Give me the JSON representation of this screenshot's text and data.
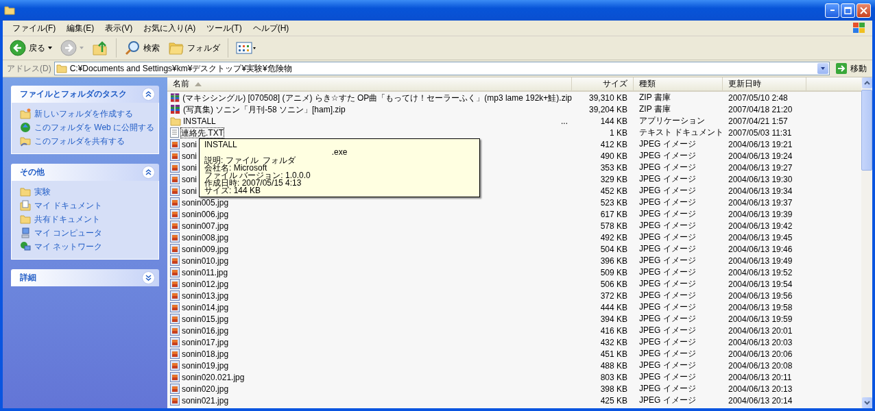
{
  "menu": [
    "ファイル(F)",
    "編集(E)",
    "表示(V)",
    "お気に入り(A)",
    "ツール(T)",
    "ヘルプ(H)"
  ],
  "toolbar": [
    {
      "kind": "back",
      "label": "戻る"
    },
    {
      "kind": "forward"
    },
    {
      "kind": "up"
    },
    {
      "kind": "search",
      "label": "検索"
    },
    {
      "kind": "folders",
      "label": "フォルダ"
    },
    {
      "kind": "views"
    }
  ],
  "address": {
    "label": "アドレス(D)",
    "value": "C:¥Documents and Settings¥km¥デスクトップ¥実験¥危険物",
    "go": "移動"
  },
  "task_panels": [
    {
      "title": "ファイルとフォルダのタスク",
      "expanded": true,
      "items": [
        {
          "kind": "new-folder",
          "label": "新しいフォルダを作成する"
        },
        {
          "kind": "globe",
          "label": "このフォルダを Web に公開する"
        },
        {
          "kind": "share",
          "label": "このフォルダを共有する"
        }
      ]
    },
    {
      "title": "その他",
      "expanded": true,
      "items": [
        {
          "kind": "folder",
          "label": "実験"
        },
        {
          "kind": "documents",
          "label": "マイ ドキュメント"
        },
        {
          "kind": "folder",
          "label": "共有ドキュメント"
        },
        {
          "kind": "computer",
          "label": "マイ コンピュータ"
        },
        {
          "kind": "network",
          "label": "マイ ネットワーク"
        }
      ]
    },
    {
      "title": "詳細",
      "expanded": false
    }
  ],
  "list": {
    "columns": [
      {
        "label": "名前",
        "sorted": true
      },
      {
        "label": "サイズ",
        "sorted": false
      },
      {
        "label": "種類",
        "sorted": false
      },
      {
        "label": "更新日時",
        "sorted": false
      }
    ],
    "rows": [
      {
        "kind": "zip",
        "name": "(マキシシングル) [070508] (アニメ) らき☆すた OP曲「もってけ！セーラーふく」(mp3 lame 192k+鮭).zip",
        "size": "39,310 KB",
        "type": "ZIP 書庫",
        "modified": "2007/05/10 2:48",
        "focused": false
      },
      {
        "kind": "zip",
        "name": "(写真集) ソニン「月刊-58 ソニン」[ham].zip",
        "size": "39,204 KB",
        "type": "ZIP 書庫",
        "modified": "2007/04/18 21:20",
        "focused": false
      },
      {
        "kind": "folder",
        "name": "INSTALL",
        "trailing": "...",
        "size": "144 KB",
        "type": "アプリケーション",
        "modified": "2007/04/21 1:57",
        "focused": false
      },
      {
        "kind": "text",
        "name": "連絡先.TXT",
        "size": "1 KB",
        "type": "テキスト ドキュメント",
        "modified": "2007/05/03 11:31",
        "focused": true
      },
      {
        "kind": "jpeg",
        "name": "soni",
        "size": "412 KB",
        "type": "JPEG イメージ",
        "modified": "2004/06/13 19:21",
        "focused": false
      },
      {
        "kind": "jpeg",
        "name": "soni",
        "size": "490 KB",
        "type": "JPEG イメージ",
        "modified": "2004/06/13 19:24",
        "focused": false
      },
      {
        "kind": "jpeg",
        "name": "soni",
        "size": "353 KB",
        "type": "JPEG イメージ",
        "modified": "2004/06/13 19:27",
        "focused": false
      },
      {
        "kind": "jpeg",
        "name": "soni",
        "size": "329 KB",
        "type": "JPEG イメージ",
        "modified": "2004/06/13 19:30",
        "focused": false
      },
      {
        "kind": "jpeg",
        "name": "soni",
        "size": "452 KB",
        "type": "JPEG イメージ",
        "modified": "2004/06/13 19:34",
        "focused": false
      },
      {
        "kind": "jpeg",
        "name": "sonin005.jpg",
        "size": "523 KB",
        "type": "JPEG イメージ",
        "modified": "2004/06/13 19:37",
        "focused": false
      },
      {
        "kind": "jpeg",
        "name": "sonin006.jpg",
        "size": "617 KB",
        "type": "JPEG イメージ",
        "modified": "2004/06/13 19:39",
        "focused": false
      },
      {
        "kind": "jpeg",
        "name": "sonin007.jpg",
        "size": "578 KB",
        "type": "JPEG イメージ",
        "modified": "2004/06/13 19:42",
        "focused": false
      },
      {
        "kind": "jpeg",
        "name": "sonin008.jpg",
        "size": "492 KB",
        "type": "JPEG イメージ",
        "modified": "2004/06/13 19:45",
        "focused": false
      },
      {
        "kind": "jpeg",
        "name": "sonin009.jpg",
        "size": "504 KB",
        "type": "JPEG イメージ",
        "modified": "2004/06/13 19:46",
        "focused": false
      },
      {
        "kind": "jpeg",
        "name": "sonin010.jpg",
        "size": "396 KB",
        "type": "JPEG イメージ",
        "modified": "2004/06/13 19:49",
        "focused": false
      },
      {
        "kind": "jpeg",
        "name": "sonin011.jpg",
        "size": "509 KB",
        "type": "JPEG イメージ",
        "modified": "2004/06/13 19:52",
        "focused": false
      },
      {
        "kind": "jpeg",
        "name": "sonin012.jpg",
        "size": "506 KB",
        "type": "JPEG イメージ",
        "modified": "2004/06/13 19:54",
        "focused": false
      },
      {
        "kind": "jpeg",
        "name": "sonin013.jpg",
        "size": "372 KB",
        "type": "JPEG イメージ",
        "modified": "2004/06/13 19:56",
        "focused": false
      },
      {
        "kind": "jpeg",
        "name": "sonin014.jpg",
        "size": "444 KB",
        "type": "JPEG イメージ",
        "modified": "2004/06/13 19:58",
        "focused": false
      },
      {
        "kind": "jpeg",
        "name": "sonin015.jpg",
        "size": "394 KB",
        "type": "JPEG イメージ",
        "modified": "2004/06/13 19:59",
        "focused": false
      },
      {
        "kind": "jpeg",
        "name": "sonin016.jpg",
        "size": "416 KB",
        "type": "JPEG イメージ",
        "modified": "2004/06/13 20:01",
        "focused": false
      },
      {
        "kind": "jpeg",
        "name": "sonin017.jpg",
        "size": "432 KB",
        "type": "JPEG イメージ",
        "modified": "2004/06/13 20:03",
        "focused": false
      },
      {
        "kind": "jpeg",
        "name": "sonin018.jpg",
        "size": "451 KB",
        "type": "JPEG イメージ",
        "modified": "2004/06/13 20:06",
        "focused": false
      },
      {
        "kind": "jpeg",
        "name": "sonin019.jpg",
        "size": "488 KB",
        "type": "JPEG イメージ",
        "modified": "2004/06/13 20:08",
        "focused": false
      },
      {
        "kind": "jpeg",
        "name": "sonin020.021.jpg",
        "size": "803 KB",
        "type": "JPEG イメージ",
        "modified": "2004/06/13 20:11",
        "focused": false
      },
      {
        "kind": "jpeg",
        "name": "sonin020.jpg",
        "size": "398 KB",
        "type": "JPEG イメージ",
        "modified": "2004/06/13 20:13",
        "focused": false
      },
      {
        "kind": "jpeg",
        "name": "sonin021.jpg",
        "size": "425 KB",
        "type": "JPEG イメージ",
        "modified": "2004/06/13 20:14",
        "focused": false
      }
    ],
    "tooltip": {
      "title": "INSTALL",
      "subtitle": ".exe",
      "lines": [
        "説明: ファイル  フォルダ",
        "会社名: Microsoft",
        "ファイル バージョン: 1.0.0.0",
        "作成日時: 2007/05/15 4:13",
        "サイズ: 144 KB"
      ]
    }
  }
}
